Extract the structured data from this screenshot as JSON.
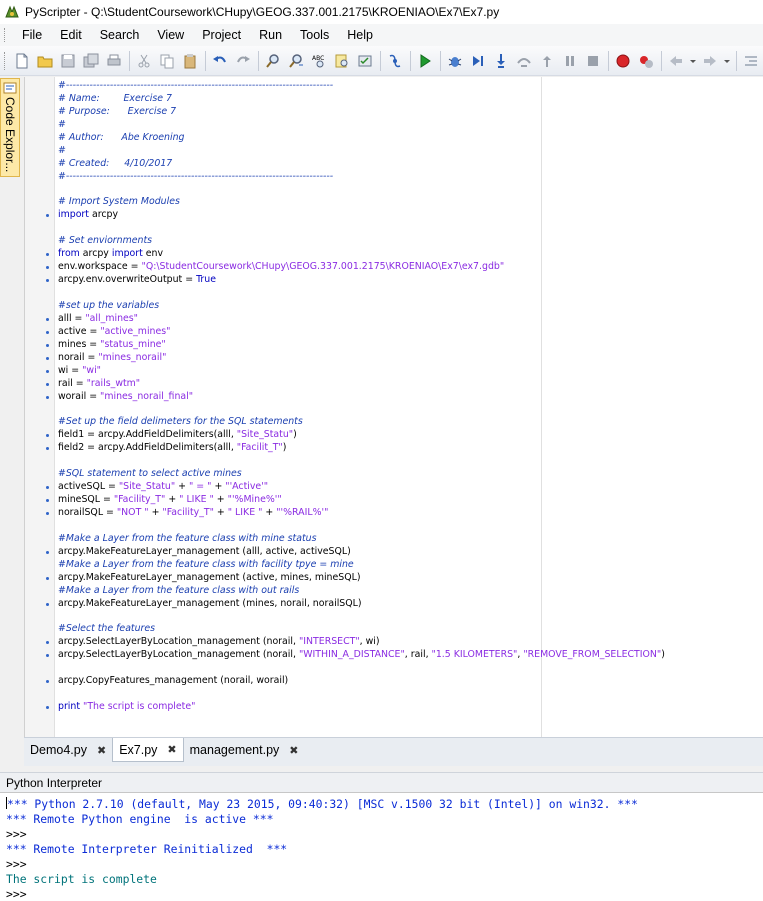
{
  "window": {
    "title": "PyScripter - Q:\\StudentCoursework\\CHupy\\GEOG.337.001.2175\\KROENIAO\\Ex7\\Ex7.py"
  },
  "menu": [
    "File",
    "Edit",
    "Search",
    "View",
    "Project",
    "Run",
    "Tools",
    "Help"
  ],
  "toolbar": {
    "buttons": [
      "new-file",
      "open-file",
      "save",
      "save-all",
      "print",
      "cut",
      "copy",
      "paste",
      "undo",
      "redo",
      "find",
      "find-next",
      "replace",
      "find-in-files",
      "syntax-check",
      "debug-info",
      "run",
      "debug",
      "run-to-cursor",
      "step-into",
      "step-over",
      "step-out",
      "pause",
      "abort",
      "toggle-breakpoint",
      "clear-breakpoints",
      "back",
      "forward"
    ]
  },
  "side_panel": {
    "label": "Code Explor..."
  },
  "editor": {
    "lines": [
      {
        "m": false,
        "t": [
          [
            "c",
            "#-------------------------------------------------------------------------------"
          ]
        ]
      },
      {
        "m": false,
        "t": [
          [
            "c",
            "# Name:        Exercise 7"
          ]
        ]
      },
      {
        "m": false,
        "t": [
          [
            "c",
            "# Purpose:      Exercise 7"
          ]
        ]
      },
      {
        "m": false,
        "t": [
          [
            "c",
            "#"
          ]
        ]
      },
      {
        "m": false,
        "t": [
          [
            "c",
            "# Author:      Abe Kroening"
          ]
        ]
      },
      {
        "m": false,
        "t": [
          [
            "c",
            "#"
          ]
        ]
      },
      {
        "m": false,
        "t": [
          [
            "c",
            "# Created:     4/10/2017"
          ]
        ]
      },
      {
        "m": false,
        "t": [
          [
            "c",
            "#-------------------------------------------------------------------------------"
          ]
        ]
      },
      {
        "m": false,
        "t": []
      },
      {
        "m": false,
        "t": [
          [
            "c",
            "# Import System Modules"
          ]
        ]
      },
      {
        "m": true,
        "t": [
          [
            "k",
            "import"
          ],
          [
            "p",
            " arcpy"
          ]
        ]
      },
      {
        "m": false,
        "t": []
      },
      {
        "m": false,
        "t": [
          [
            "c",
            "# Set enviornments"
          ]
        ]
      },
      {
        "m": true,
        "t": [
          [
            "k",
            "from"
          ],
          [
            "p",
            " arcpy "
          ],
          [
            "k",
            "import"
          ],
          [
            "p",
            " env"
          ]
        ]
      },
      {
        "m": true,
        "t": [
          [
            "p",
            "env.workspace = "
          ],
          [
            "s",
            "\"Q:\\StudentCoursework\\CHupy\\GEOG.337.001.2175\\KROENIAO\\Ex7\\ex7.gdb\""
          ]
        ]
      },
      {
        "m": true,
        "t": [
          [
            "p",
            "arcpy.env.overwriteOutput = "
          ],
          [
            "k",
            "True"
          ]
        ]
      },
      {
        "m": false,
        "t": []
      },
      {
        "m": false,
        "t": [
          [
            "c",
            "#set up the variables"
          ]
        ]
      },
      {
        "m": true,
        "t": [
          [
            "p",
            "alll = "
          ],
          [
            "s",
            "\"all_mines\""
          ]
        ]
      },
      {
        "m": true,
        "t": [
          [
            "p",
            "active = "
          ],
          [
            "s",
            "\"active_mines\""
          ]
        ]
      },
      {
        "m": true,
        "t": [
          [
            "p",
            "mines = "
          ],
          [
            "s",
            "\"status_mine\""
          ]
        ]
      },
      {
        "m": true,
        "t": [
          [
            "p",
            "norail = "
          ],
          [
            "s",
            "\"mines_norail\""
          ]
        ]
      },
      {
        "m": true,
        "t": [
          [
            "p",
            "wi = "
          ],
          [
            "s",
            "\"wi\""
          ]
        ]
      },
      {
        "m": true,
        "t": [
          [
            "p",
            "rail = "
          ],
          [
            "s",
            "\"rails_wtm\""
          ]
        ]
      },
      {
        "m": true,
        "t": [
          [
            "p",
            "worail = "
          ],
          [
            "s",
            "\"mines_norail_final\""
          ]
        ]
      },
      {
        "m": false,
        "t": []
      },
      {
        "m": false,
        "t": [
          [
            "c",
            "#Set up the field delimeters for the SQL statements"
          ]
        ]
      },
      {
        "m": true,
        "t": [
          [
            "p",
            "field1 = arcpy.AddFieldDelimiters(alll, "
          ],
          [
            "s",
            "\"Site_Statu\""
          ],
          [
            "p",
            ")"
          ]
        ]
      },
      {
        "m": true,
        "t": [
          [
            "p",
            "field2 = arcpy.AddFieldDelimiters(alll, "
          ],
          [
            "s",
            "\"Facilit_T\""
          ],
          [
            "p",
            ")"
          ]
        ]
      },
      {
        "m": false,
        "t": []
      },
      {
        "m": false,
        "t": [
          [
            "c",
            "#SQL statement to select active mines"
          ]
        ]
      },
      {
        "m": true,
        "t": [
          [
            "p",
            "activeSQL = "
          ],
          [
            "s",
            "\"Site_Statu\""
          ],
          [
            "p",
            " + "
          ],
          [
            "s",
            "\" = \""
          ],
          [
            "p",
            " + "
          ],
          [
            "s",
            "\"'Active'\""
          ]
        ]
      },
      {
        "m": true,
        "t": [
          [
            "p",
            "mineSQL = "
          ],
          [
            "s",
            "\"Facility_T\""
          ],
          [
            "p",
            " + "
          ],
          [
            "s",
            "\" LIKE \""
          ],
          [
            "p",
            " + "
          ],
          [
            "s",
            "\"'%Mine%'\""
          ]
        ]
      },
      {
        "m": true,
        "t": [
          [
            "p",
            "norailSQL = "
          ],
          [
            "s",
            "\"NOT \""
          ],
          [
            "p",
            " + "
          ],
          [
            "s",
            "\"Facility_T\""
          ],
          [
            "p",
            " + "
          ],
          [
            "s",
            "\" LIKE \""
          ],
          [
            "p",
            " + "
          ],
          [
            "s",
            "\"'%RAIL%'\""
          ]
        ]
      },
      {
        "m": false,
        "t": []
      },
      {
        "m": false,
        "t": [
          [
            "c",
            "#Make a Layer from the feature class with mine status"
          ]
        ]
      },
      {
        "m": true,
        "t": [
          [
            "p",
            "arcpy.MakeFeatureLayer_management (alll, active, activeSQL)"
          ]
        ]
      },
      {
        "m": false,
        "t": [
          [
            "c",
            "#Make a Layer from the feature class with facility tpye = mine"
          ]
        ]
      },
      {
        "m": true,
        "t": [
          [
            "p",
            "arcpy.MakeFeatureLayer_management (active, mines, mineSQL)"
          ]
        ]
      },
      {
        "m": false,
        "t": [
          [
            "c",
            "#Make a Layer from the feature class with out rails"
          ]
        ]
      },
      {
        "m": true,
        "t": [
          [
            "p",
            "arcpy.MakeFeatureLayer_management (mines, norail, norailSQL)"
          ]
        ]
      },
      {
        "m": false,
        "t": []
      },
      {
        "m": false,
        "t": [
          [
            "c",
            "#Select the features"
          ]
        ]
      },
      {
        "m": true,
        "t": [
          [
            "p",
            "arcpy.SelectLayerByLocation_management (norail, "
          ],
          [
            "s",
            "\"INTERSECT\""
          ],
          [
            "p",
            ", wi)"
          ]
        ]
      },
      {
        "m": true,
        "t": [
          [
            "p",
            "arcpy.SelectLayerByLocation_management (norail, "
          ],
          [
            "s",
            "\"WITHIN_A_DISTANCE\""
          ],
          [
            "p",
            ", rail, "
          ],
          [
            "s",
            "\"1.5 KILOMETERS\""
          ],
          [
            "p",
            ", "
          ],
          [
            "s",
            "\"REMOVE_FROM_SELECTION\""
          ],
          [
            "p",
            ")"
          ]
        ]
      },
      {
        "m": false,
        "t": []
      },
      {
        "m": true,
        "t": [
          [
            "p",
            "arcpy.CopyFeatures_management (norail, worail)"
          ]
        ]
      },
      {
        "m": false,
        "t": []
      },
      {
        "m": true,
        "t": [
          [
            "k",
            "print"
          ],
          [
            "p",
            " "
          ],
          [
            "s",
            "\"The script is complete\""
          ]
        ]
      }
    ]
  },
  "tabs": [
    {
      "label": "Demo4.py",
      "active": false
    },
    {
      "label": "Ex7.py",
      "active": true
    },
    {
      "label": "management.py",
      "active": false
    }
  ],
  "interpreter": {
    "header": "Python Interpreter",
    "lines": [
      {
        "text": "*** Python 2.7.10 (default, May 23 2015, 09:40:32) [MSC v.1500 32 bit (Intel)] on win32. ***",
        "color": "blue",
        "cursor": true
      },
      {
        "text": "*** Remote Python engine  is active ***",
        "color": "blue"
      },
      {
        "text": ">>>",
        "color": "black"
      },
      {
        "text": "*** Remote Interpreter Reinitialized  ***",
        "color": "blue"
      },
      {
        "text": ">>>",
        "color": "black"
      },
      {
        "text": "The script is complete",
        "color": "teal"
      },
      {
        "text": ">>>",
        "color": "black"
      }
    ]
  }
}
